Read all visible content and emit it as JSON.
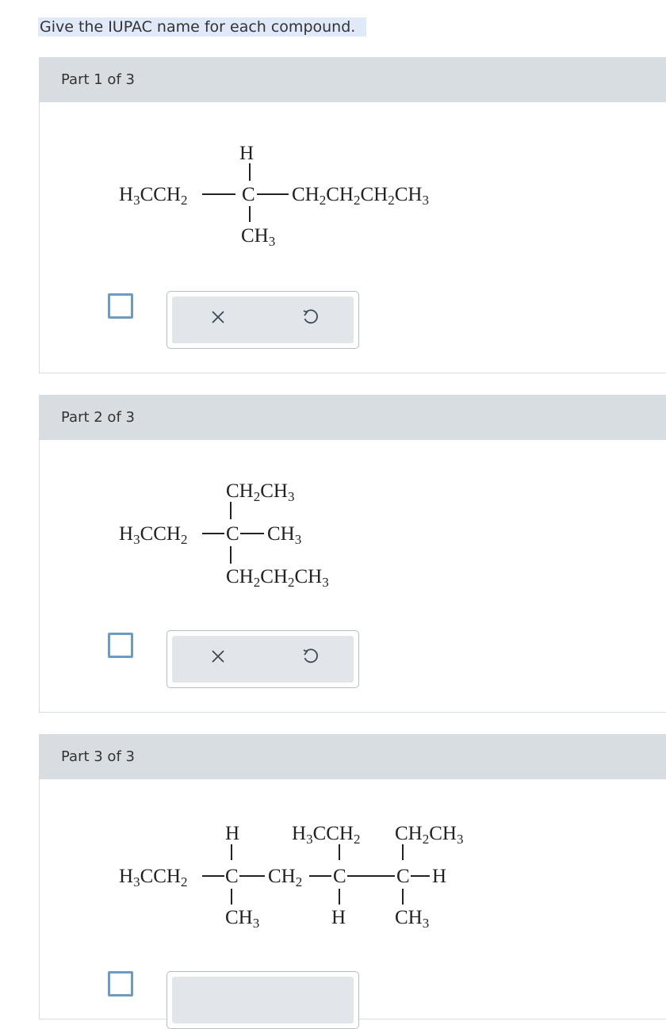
{
  "instruction": "Give the IUPAC name for each compound.",
  "parts": [
    {
      "header": "Part 1 of 3",
      "structure": {
        "top": "H",
        "left_main": "H",
        "left_sub1": "3",
        "left_main2": "CCH",
        "left_sub2": "2",
        "center": "C",
        "right": [
          [
            "CH",
            "2"
          ],
          [
            "CH",
            "2"
          ],
          [
            "CH",
            "2"
          ],
          [
            "CH",
            "3"
          ]
        ],
        "bottom_main": "CH",
        "bottom_sub": "3"
      }
    },
    {
      "header": "Part 2 of 3",
      "structure": {
        "top": [
          [
            "CH",
            "2"
          ],
          [
            "CH",
            "3"
          ]
        ],
        "left": [
          [
            "H",
            "3"
          ],
          [
            "CCH",
            "2"
          ]
        ],
        "center": "C",
        "right": [
          [
            "CH",
            "3"
          ]
        ],
        "bottom": [
          [
            "CH",
            "2"
          ],
          [
            "CH",
            "2"
          ],
          [
            "CH",
            "3"
          ]
        ]
      }
    },
    {
      "header": "Part 3 of 3"
    }
  ],
  "icons": {
    "clear": "x-icon",
    "reset": "undo-icon"
  },
  "colors": {
    "header_bg": "#d8dde1",
    "checkbox_border": "#6b9cc6",
    "toolbox_bg": "#e2e6ea",
    "instruction_highlight": "#dfe9f7"
  }
}
